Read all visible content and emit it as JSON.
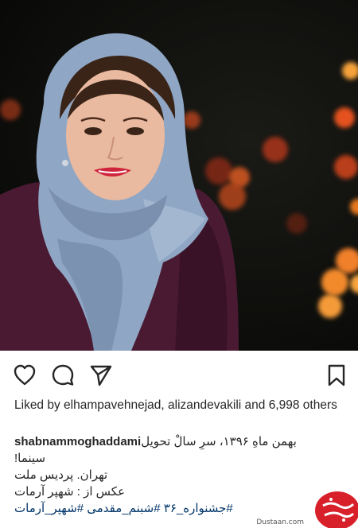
{
  "post": {
    "image_alt": "portrait photo",
    "likes_text": "Liked by elhampavehnejad, alizandevakili and 6,998 others",
    "caption": {
      "username": "shabnammoghaddami",
      "line1": "بهمن ماهِ ۱۳۹۶، سرِ سالْ تحویل",
      "line2": "سینما!",
      "line3": "تهران. پردیس ملت",
      "line4": "عکس از : شهپر آرمات",
      "line5": "#جشنواره_۳۶ #شبنم_مقدمی #شهپر_آرمات"
    }
  },
  "actions": {
    "like_icon": "heart-icon",
    "comment_icon": "comment-icon",
    "share_icon": "send-icon",
    "save_icon": "bookmark-icon"
  },
  "watermark": {
    "text": "Dustaan.com"
  },
  "colors": {
    "text": "#262626",
    "background": "#ffffff",
    "scarf": "#8fa6c4",
    "sweater": "#4a1a33",
    "bokeh": "#f07a2a",
    "watermark": "#d8202a"
  }
}
